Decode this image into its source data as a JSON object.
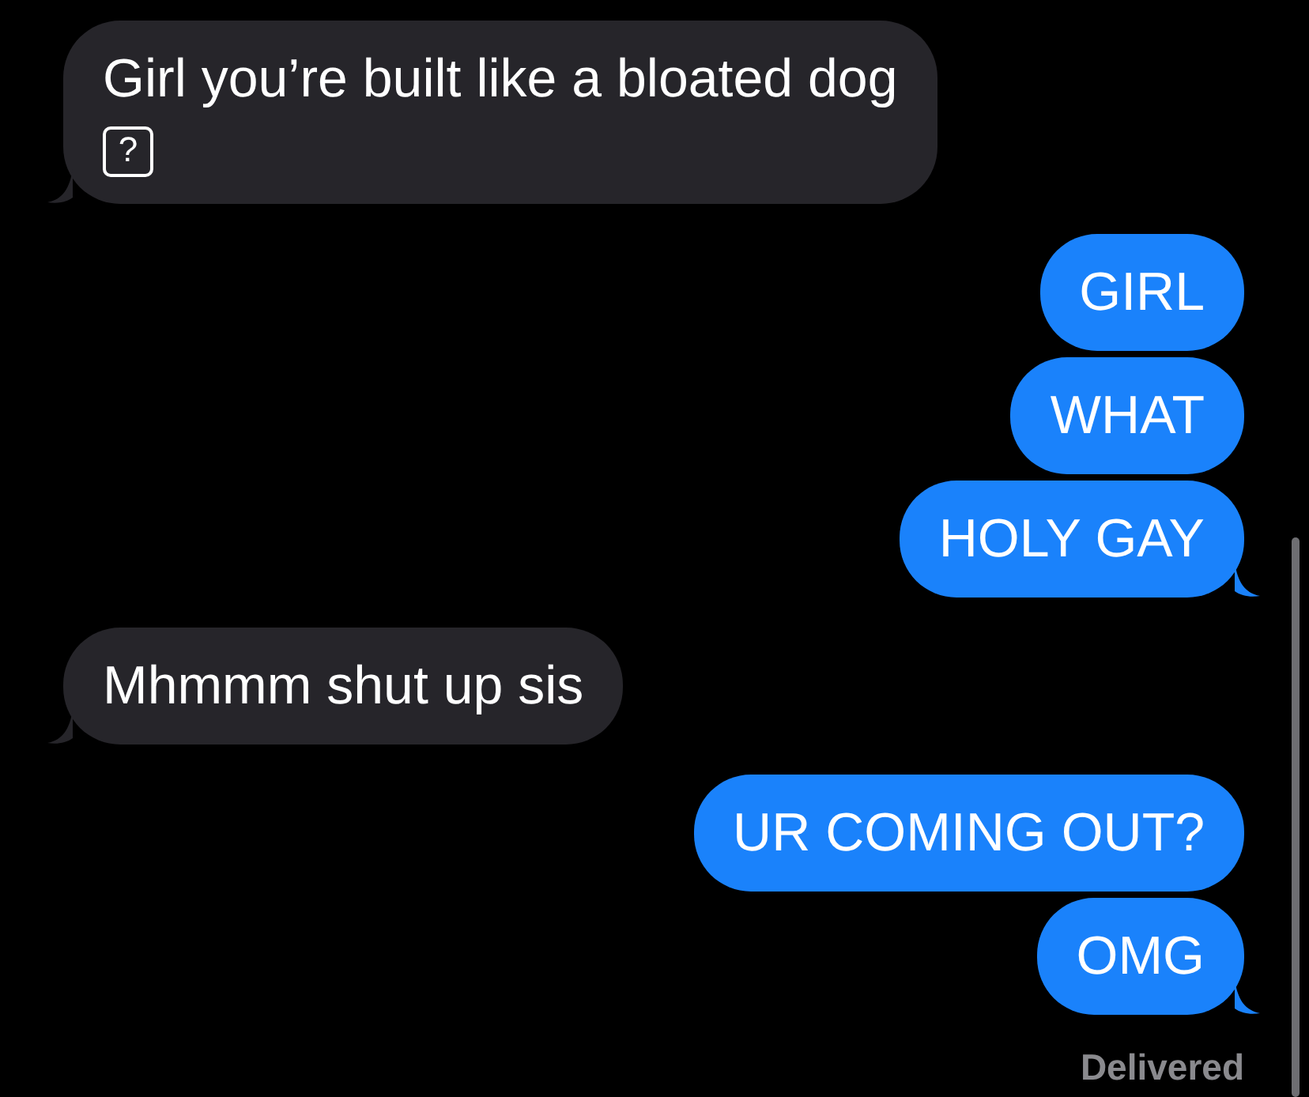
{
  "messages": [
    {
      "kind": "received",
      "text": "Girl you’re built like a bloated dog",
      "symbol": "?",
      "tail": true
    },
    {
      "kind": "sent",
      "text": "GIRL",
      "tail": false
    },
    {
      "kind": "sent",
      "text": "WHAT",
      "tail": false
    },
    {
      "kind": "sent",
      "text": "HOLY GAY",
      "tail": true
    },
    {
      "kind": "received",
      "text": "Mhmmm shut up sis",
      "tail": true
    },
    {
      "kind": "sent",
      "text": "UR COMING OUT?",
      "tail": false
    },
    {
      "kind": "sent",
      "text": "OMG",
      "tail": true
    }
  ],
  "status": "Delivered"
}
